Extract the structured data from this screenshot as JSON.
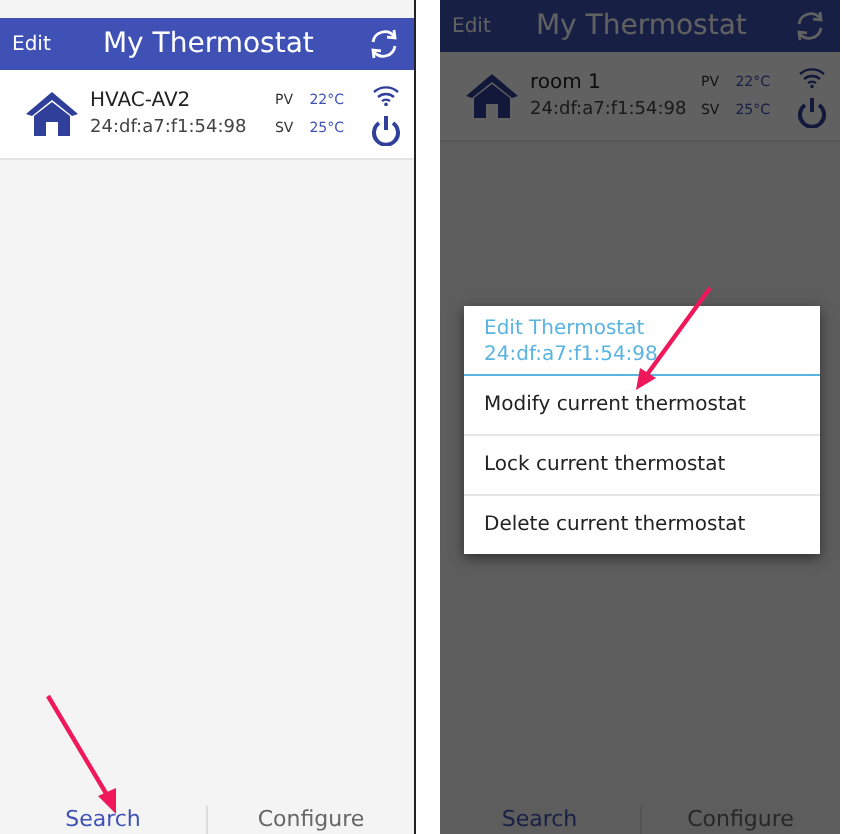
{
  "screens": [
    {
      "dimmed": false,
      "header": {
        "edit": "Edit",
        "title": "My Thermostat"
      },
      "devices": [
        {
          "name": "HVAC-AV2",
          "mac": "24:df:a7:f1:54:98",
          "pv_label": "PV",
          "pv": "22°C",
          "sv_label": "SV",
          "sv": "25°C"
        }
      ],
      "tabs": [
        {
          "label": "Search",
          "selected": true
        },
        {
          "label": "Configure",
          "selected": false
        }
      ]
    },
    {
      "dimmed": true,
      "header": {
        "edit": "Edit",
        "title": "My Thermostat"
      },
      "devices": [
        {
          "name": "room 1",
          "mac": "24:df:a7:f1:54:98",
          "pv_label": "PV",
          "pv": "22°C",
          "sv_label": "SV",
          "sv": "25°C"
        }
      ],
      "tabs": [
        {
          "label": "Search",
          "selected": true
        },
        {
          "label": "Configure",
          "selected": false
        }
      ],
      "dialog": {
        "title": "Edit Thermostat",
        "subtitle": "24:df:a7:f1:54:98",
        "items": [
          "Modify current thermostat",
          "Lock current thermostat",
          "Delete current thermostat"
        ]
      }
    }
  ]
}
